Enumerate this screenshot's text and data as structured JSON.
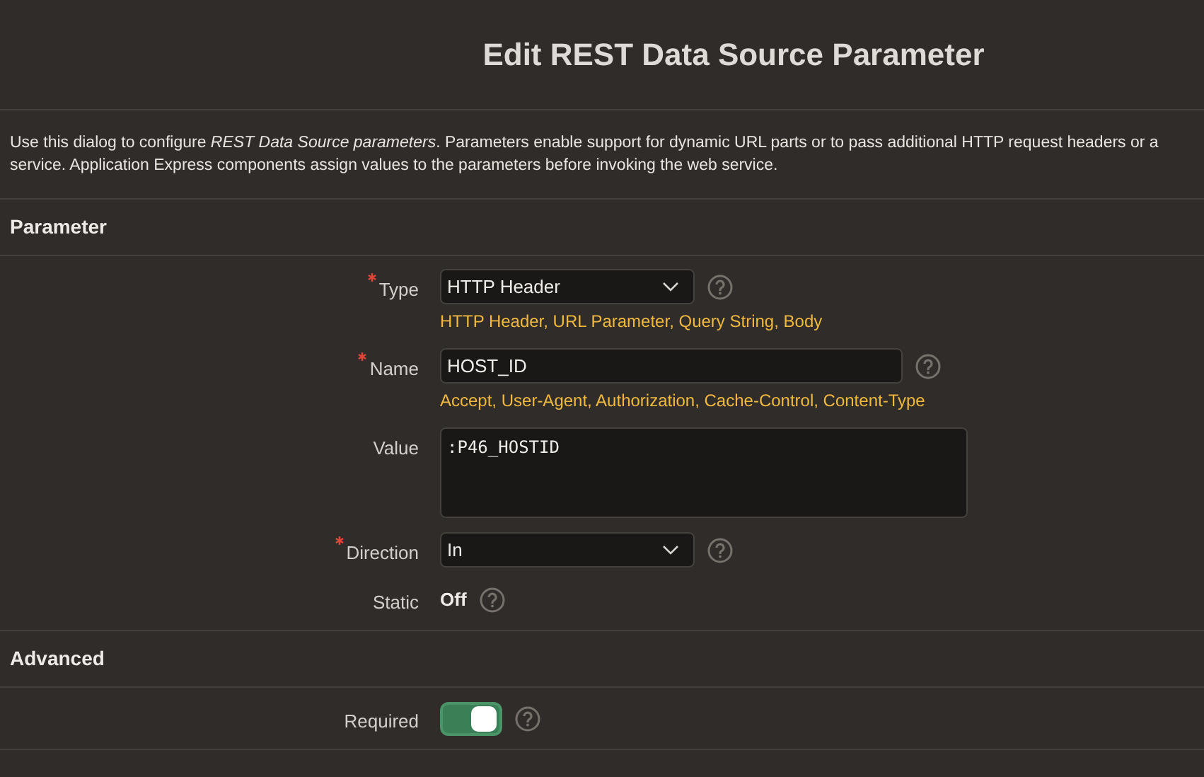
{
  "dialog": {
    "title": "Edit REST Data Source Parameter"
  },
  "description": "Use this dialog to configure *REST Data Source parameters*. Parameters enable support for dynamic URL parts or to pass additional HTTP request headers or a service. Application Express components assign values to the parameters before invoking the web service.",
  "sections": [
    {
      "title": "Parameter",
      "fields": [
        {
          "kind": "select",
          "label": "Type",
          "required": true,
          "value": "HTTP Header",
          "help": true,
          "hint": "HTTP Header, URL Parameter, Query String, Body"
        },
        {
          "kind": "text",
          "label": "Name",
          "required": true,
          "value": "HOST_ID",
          "help": true,
          "hint": "Accept, User-Agent, Authorization, Cache-Control, Content-Type"
        },
        {
          "kind": "textarea",
          "label": "Value",
          "required": false,
          "value": ":P46_HOSTID",
          "help": false
        },
        {
          "kind": "select",
          "label": "Direction",
          "required": true,
          "value": "In",
          "help": true
        },
        {
          "kind": "display",
          "label": "Static",
          "required": false,
          "value": "Off",
          "help": true
        }
      ]
    },
    {
      "title": "Advanced",
      "fields": [
        {
          "kind": "switch",
          "label": "Required",
          "required": false,
          "on": true,
          "help": true
        }
      ]
    }
  ]
}
